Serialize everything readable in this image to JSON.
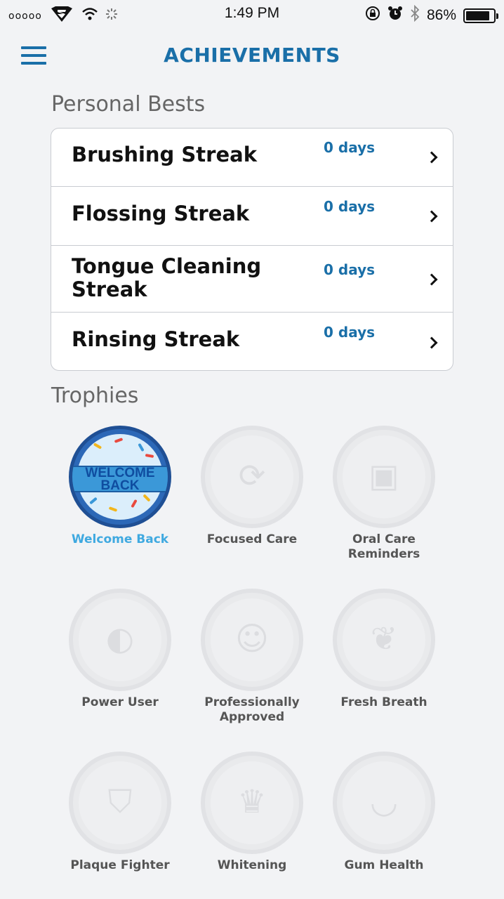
{
  "status_bar": {
    "signal": "ooooo",
    "time": "1:49 PM",
    "battery_percent": "86%",
    "battery_level": 0.86,
    "icons": [
      "superman-icon",
      "wifi-icon",
      "activity-icon",
      "rotation-lock-icon",
      "alarm-icon",
      "bluetooth-icon",
      "battery-icon"
    ]
  },
  "header": {
    "title": "ACHIEVEMENTS",
    "menu_icon": "hamburger-icon"
  },
  "personal_bests": {
    "title": "Personal Bests",
    "items": [
      {
        "label": "Brushing Streak",
        "value": "0 days"
      },
      {
        "label": "Flossing Streak",
        "value": "0 days"
      },
      {
        "label": "Tongue Cleaning Streak",
        "value": "0 days"
      },
      {
        "label": "Rinsing Streak",
        "value": "0 days"
      }
    ]
  },
  "trophies": {
    "title": "Trophies",
    "active_badge_text": "WELCOME BACK",
    "items": [
      {
        "label": "Welcome Back",
        "unlocked": true
      },
      {
        "label": "Focused Care",
        "unlocked": false
      },
      {
        "label": "Oral Care Reminders",
        "unlocked": false
      },
      {
        "label": "Power User",
        "unlocked": false
      },
      {
        "label": "Professionally Approved",
        "unlocked": false
      },
      {
        "label": "Fresh Breath",
        "unlocked": false
      },
      {
        "label": "Plaque Fighter",
        "unlocked": false
      },
      {
        "label": "Whitening",
        "unlocked": false
      },
      {
        "label": "Gum Health",
        "unlocked": false
      }
    ]
  },
  "colors": {
    "accent": "#1a6fa8",
    "unlocked_label": "#3fa9e0",
    "background": "#f2f3f5"
  }
}
